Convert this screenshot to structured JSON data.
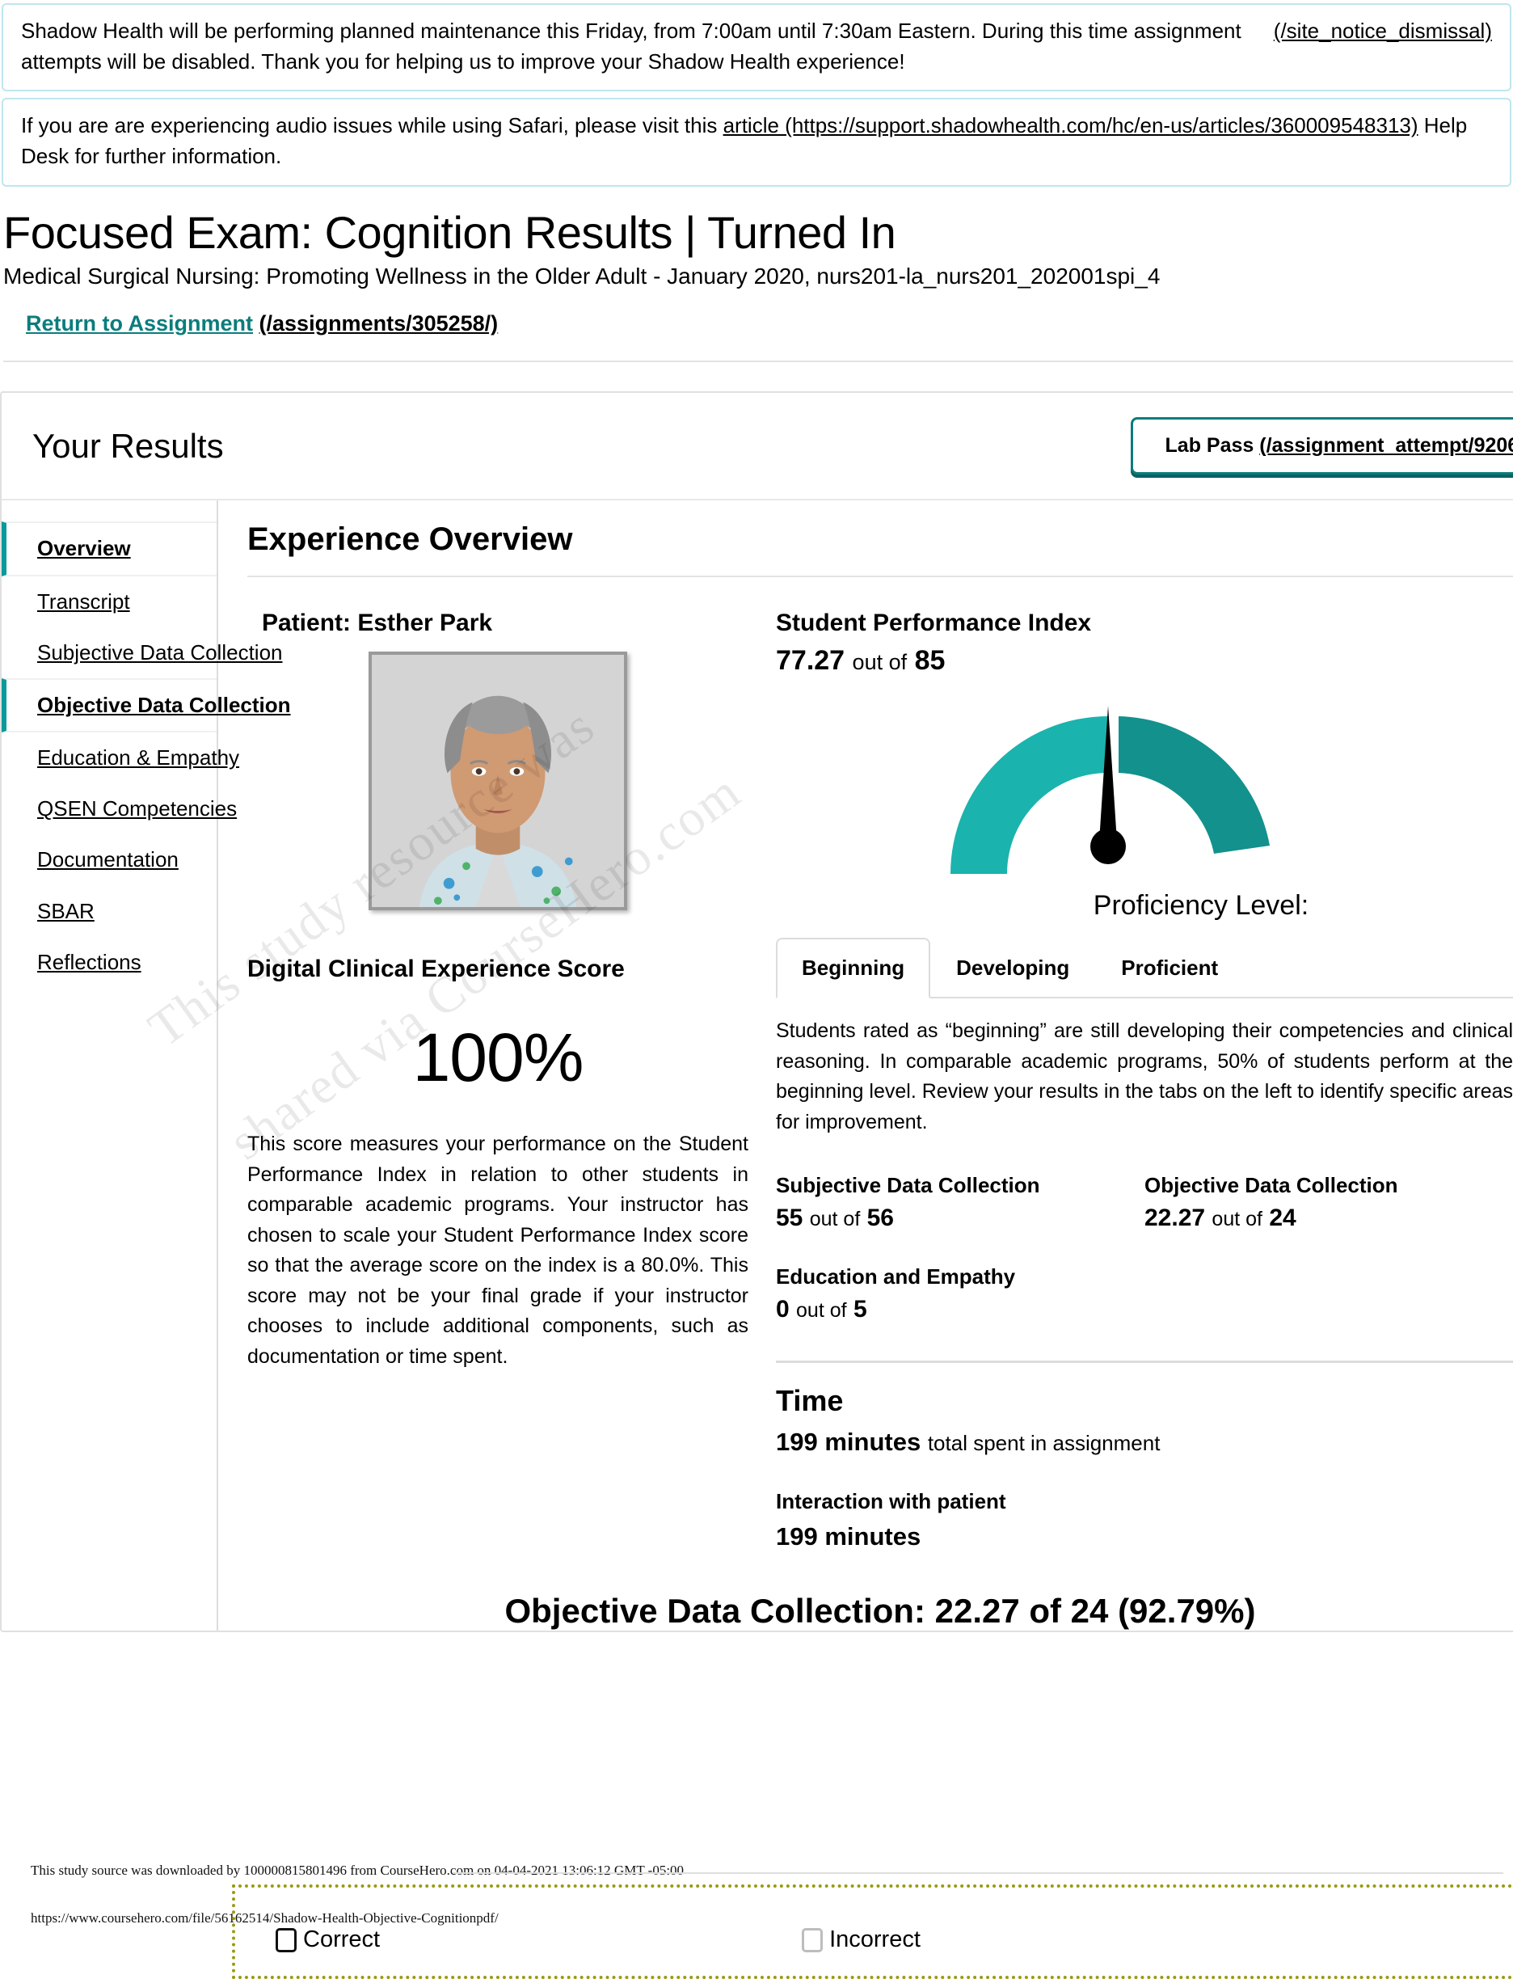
{
  "notices": [
    {
      "name": "maintenance-notice",
      "text": "Shadow Health will be performing planned maintenance this Friday, from 7:00am until 7:30am Eastern. During this time assignment attempts will be disabled. Thank you for helping us to improve your Shadow Health experience!",
      "dismiss_link": "(/site_notice_dismissal)"
    },
    {
      "name": "audio-notice",
      "text_before": "If you are are experiencing audio issues while using Safari, please visit this ",
      "link": "article (https://support.shadowhealth.com/hc/en-us/articles/360009548313)",
      "text_after": " Help Desk for further information."
    }
  ],
  "header": {
    "title": "Focused Exam: Cognition Results | Turned In",
    "course": "Medical Surgical Nursing: Promoting Wellness in the Older Adult - January 2020, nurs201-la_nurs201_202001spi_4",
    "return_label": "Return to Assignment",
    "return_url": "(/assignments/305258/)"
  },
  "results": {
    "heading": "Your Results",
    "lab_pass_label": "Lab Pass",
    "lab_pass_url": "(/assignment_attempt/9206977/lab_pass.pdf)"
  },
  "sidebar": {
    "items": [
      {
        "label": "Overview",
        "active": true
      },
      {
        "label": "Transcript",
        "active": false
      },
      {
        "label": "Subjective Data Collection",
        "active": false
      },
      {
        "label": "Objective Data Collection",
        "active": true
      },
      {
        "label": "Education & Empathy",
        "active": false
      },
      {
        "label": "QSEN Competencies",
        "active": false
      },
      {
        "label": "Documentation",
        "active": false
      },
      {
        "label": "SBAR",
        "active": false
      },
      {
        "label": "Reflections",
        "active": false
      }
    ]
  },
  "overview": {
    "section_title": "Experience Overview",
    "patient_label": "Patient: Esther Park",
    "dces_label": "Digital Clinical Experience Score",
    "dces_value": "100%",
    "dces_description": "This score measures your performance on the Student Performance Index in relation to other students in comparable academic programs. Your instructor has chosen to scale your Student Performance Index score so that the average score on the index is a 80.0%. This score may not be your final grade if your instructor chooses to include additional components, such as documentation or time spent."
  },
  "performance": {
    "spi_label": "Student Performance Index",
    "spi_score": "77.27",
    "spi_out_of_word": "out of",
    "spi_total": "85",
    "proficiency_title": "Proficiency Level:",
    "tabs": [
      {
        "label": "Beginning",
        "active": true
      },
      {
        "label": "Developing",
        "active": false
      },
      {
        "label": "Proficient",
        "active": false
      }
    ],
    "proficiency_description": "Students rated as “beginning” are still developing their competencies and clinical reasoning. In comparable academic programs, 50% of students perform at the beginning level. Review your results in the tabs on the left to identify specific areas for improvement.",
    "scores": [
      {
        "name": "Subjective Data Collection",
        "value": "55",
        "out_of_word": "out of",
        "total": "56"
      },
      {
        "name": "Objective Data Collection",
        "value": "22.27",
        "out_of_word": "out of",
        "total": "24"
      },
      {
        "name": "Education and Empathy",
        "value": "0",
        "out_of_word": "out of",
        "total": "5"
      }
    ],
    "time": {
      "title": "Time",
      "total_value": "199 minutes",
      "total_suffix": "total spent in assignment",
      "interaction_label": "Interaction with patient",
      "interaction_value": "199 minutes"
    }
  },
  "objective_section": {
    "heading": "Objective Data Collection: 22.27 of 24 (92.79%)",
    "options": [
      {
        "label": "Correct",
        "checked": false,
        "style": "dark"
      },
      {
        "label": "Incorrect",
        "checked": false,
        "style": "light"
      }
    ]
  },
  "coursehero": {
    "download_line": "This study source was downloaded by 100000815801496 from CourseHero.com on 04-04-2021 13:06:12 GMT -05:00",
    "url_line": "https://www.coursehero.com/file/56162514/Shadow-Health-Objective-Cognitionpdf/",
    "watermark_line1": "This study resource was",
    "watermark_line2": "shared via CourseHero.com"
  },
  "colors": {
    "accent_teal": "#1bb3ad",
    "link_teal": "#0b7c7c",
    "notice_border": "#bfe6ed",
    "olive_dotted": "#9a9a12"
  }
}
